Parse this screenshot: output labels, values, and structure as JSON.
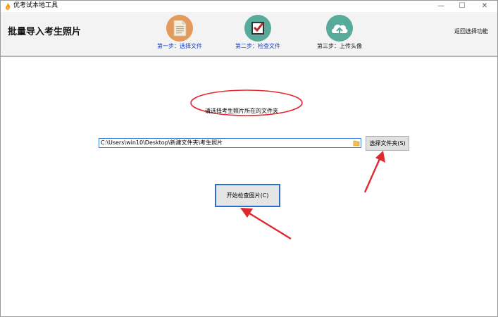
{
  "window": {
    "title": "优考试本地工具",
    "minimize_glyph": "—",
    "maximize_glyph": "☐",
    "close_glyph": "✕"
  },
  "header": {
    "title": "批量导入考生照片",
    "back_label": "返回选择功能",
    "steps": [
      {
        "icon": "document-icon",
        "label": "第一步：选择文件",
        "color": "#e39a5b"
      },
      {
        "icon": "checkbox-icon",
        "label": "第二步：检查文件",
        "color": "#58ab9a"
      },
      {
        "icon": "cloud-upload-icon",
        "label": "第三步：上传头像",
        "color": "#58ab9a"
      }
    ]
  },
  "main": {
    "prompt": "请选择考生照片所在的文件夹",
    "folder_path": "C:\\Users\\win10\\Desktop\\新建文件夹\\考生照片",
    "choose_folder_label": "选择文件夹(S)",
    "start_check_label": "开始检查图片(C)"
  },
  "colors": {
    "annotation_red": "#e0292f",
    "focus_blue": "#2a6fc4",
    "link_blue": "#1a3fbf"
  }
}
